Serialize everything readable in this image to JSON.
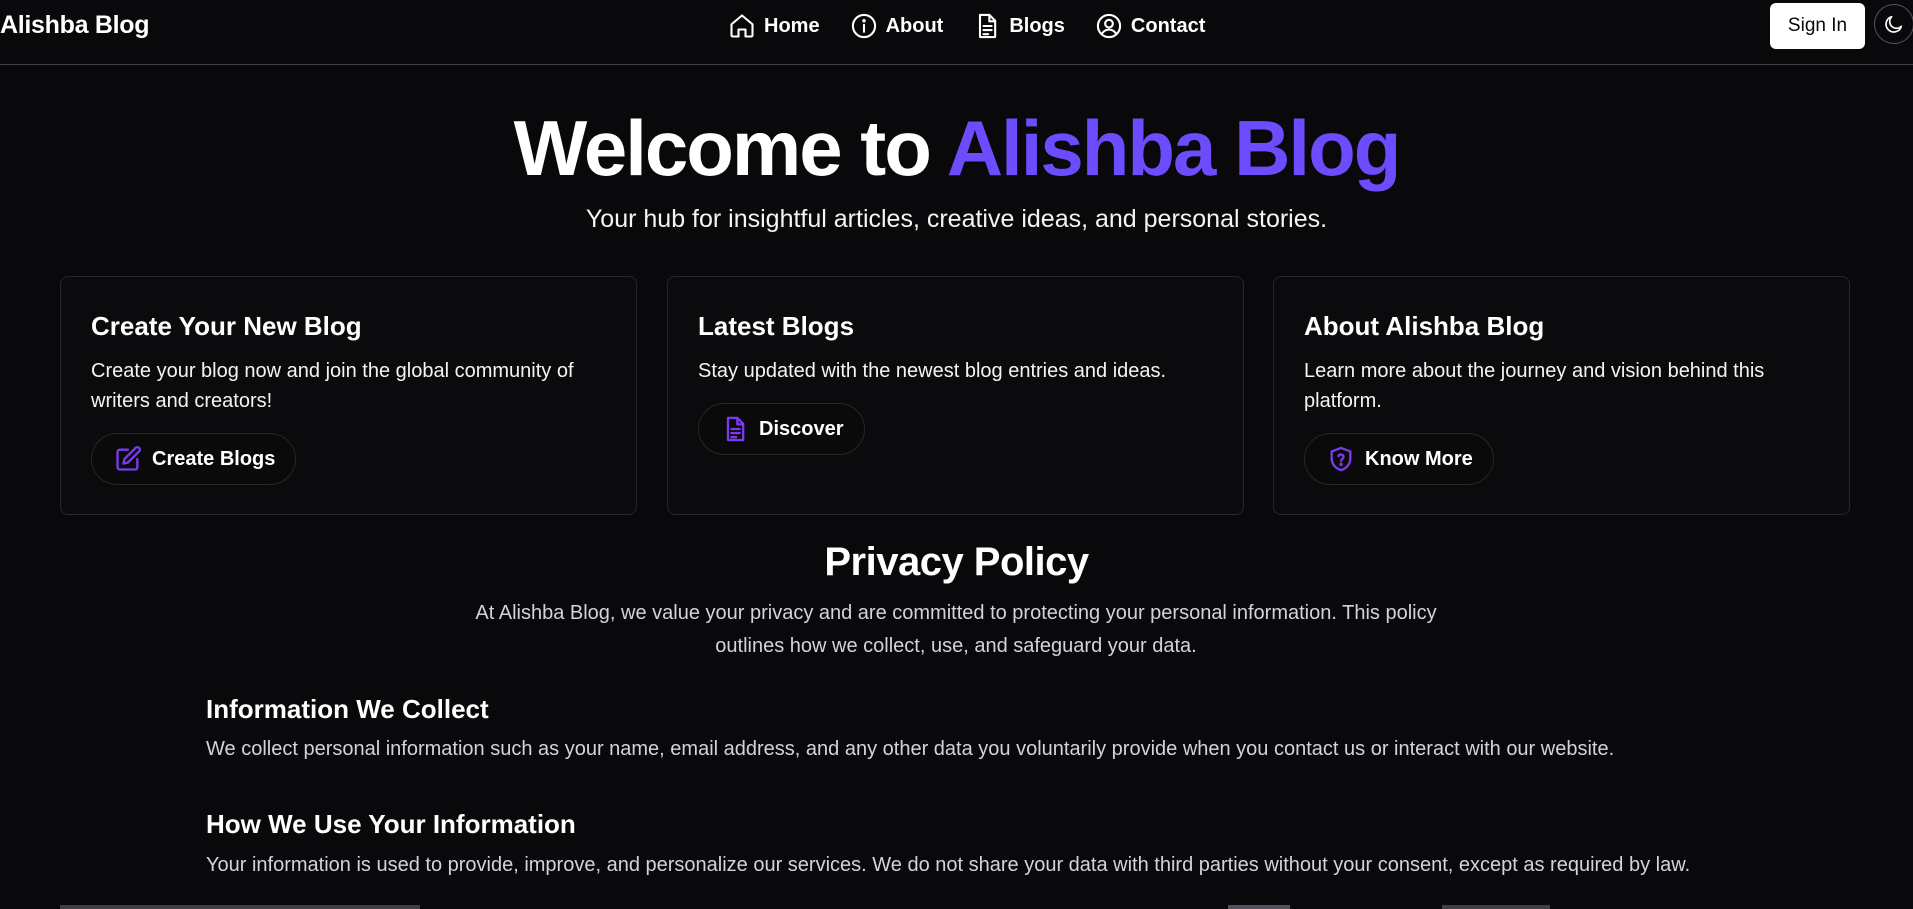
{
  "brand": "Alishba Blog",
  "nav": [
    {
      "label": "Home",
      "icon": "home-icon"
    },
    {
      "label": "About",
      "icon": "info-icon"
    },
    {
      "label": "Blogs",
      "icon": "document-icon"
    },
    {
      "label": "Contact",
      "icon": "user-circle-icon"
    }
  ],
  "auth": {
    "sign_in": "Sign In"
  },
  "theme_toggle": {
    "icon": "moon-icon"
  },
  "hero": {
    "title_prefix": "Welcome to ",
    "title_accent": "Alishba Blog",
    "subtitle": "Your hub for insightful articles, creative ideas, and personal stories."
  },
  "cards": [
    {
      "title": "Create Your New Blog",
      "text": "Create your blog now and join the global community of writers and creators!",
      "button": "Create Blogs",
      "icon": "edit-icon"
    },
    {
      "title": "Latest Blogs",
      "text": "Stay updated with the newest blog entries and ideas.",
      "button": "Discover",
      "icon": "document-icon"
    },
    {
      "title": "About Alishba Blog",
      "text": "Learn more about the journey and vision behind this platform.",
      "button": "Know More",
      "icon": "shield-question-icon"
    }
  ],
  "privacy": {
    "title": "Privacy Policy",
    "intro": "At Alishba Blog, we value your privacy and are committed to protecting your personal information. This policy outlines how we collect, use, and safeguard your data.",
    "sections": [
      {
        "heading": "Information We Collect",
        "text": "We collect personal information such as your name, email address, and any other data you voluntarily provide when you contact us or interact with our website."
      },
      {
        "heading": "How We Use Your Information",
        "text": "Your information is used to provide, improve, and personalize our services. We do not share your data with third parties without your consent, except as required by law."
      }
    ]
  },
  "colors": {
    "background": "#09090b",
    "accent": "#6d4cff",
    "icon_accent": "#7c3aed",
    "border": "#27272a"
  }
}
